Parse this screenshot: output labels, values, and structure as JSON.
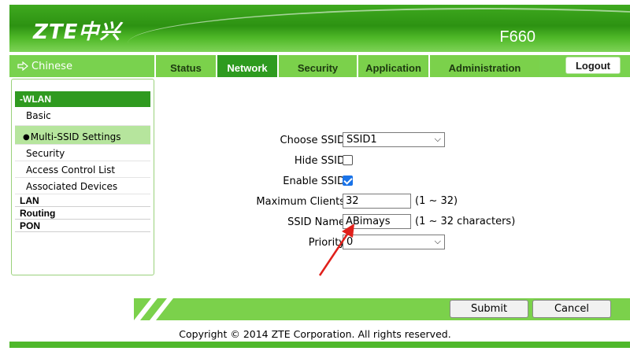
{
  "header": {
    "brand": "ZTE中兴",
    "model": "F660"
  },
  "nav": {
    "language": "Chinese",
    "tabs": [
      {
        "label": "Status",
        "active": false
      },
      {
        "label": "Network",
        "active": true
      },
      {
        "label": "Security",
        "active": false
      },
      {
        "label": "Application",
        "active": false
      },
      {
        "label": "Administration",
        "active": false
      }
    ],
    "logout": "Logout"
  },
  "sidebar": {
    "section_wlan": "-WLAN",
    "items": [
      "Basic",
      "Multi-SSID Settings",
      "Security",
      "Access Control List",
      "Associated Devices"
    ],
    "active_item": "Multi-SSID Settings",
    "sections": [
      "LAN",
      "Routing",
      "PON"
    ]
  },
  "form": {
    "choose_ssid": {
      "label": "Choose SSID",
      "value": "SSID1"
    },
    "hide_ssid": {
      "label": "Hide SSID",
      "checked": false
    },
    "enable_ssid": {
      "label": "Enable SSID",
      "checked": true
    },
    "max_clients": {
      "label": "Maximum Clients",
      "value": "32",
      "hint": "(1 ~ 32)"
    },
    "ssid_name": {
      "label": "SSID Name",
      "value": "ABimays",
      "hint": "(1 ~ 32 characters)"
    },
    "priority": {
      "label": "Priority",
      "value": "0"
    }
  },
  "actions": {
    "submit": "Submit",
    "cancel": "Cancel"
  },
  "footer": {
    "copyright": "Copyright © 2014 ZTE Corporation. All rights reserved."
  },
  "colors": {
    "brand_green": "#2e9b1f",
    "light_green": "#79d24e",
    "arrow": "#e0201b",
    "checkbox": "#1a73e8"
  }
}
